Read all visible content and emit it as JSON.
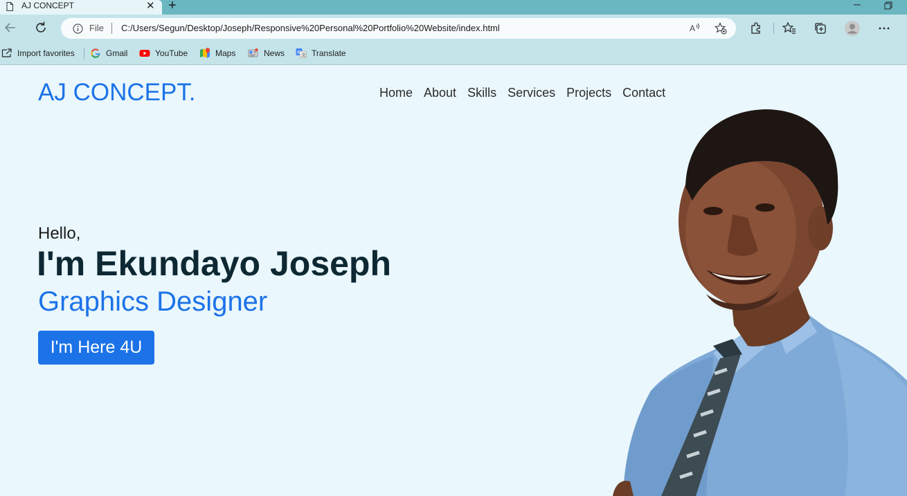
{
  "browser": {
    "tab_title": "AJ CONCEPT",
    "scheme_label": "File",
    "url": "C:/Users/Segun/Desktop/Joseph/Responsive%20Personal%20Portfolio%20Website/index.html"
  },
  "bookmarks": [
    {
      "label": "Import favorites",
      "icon": "import-favorites-icon"
    },
    {
      "label": "Gmail",
      "icon": "google-icon"
    },
    {
      "label": "YouTube",
      "icon": "youtube-icon"
    },
    {
      "label": "Maps",
      "icon": "maps-icon"
    },
    {
      "label": "News",
      "icon": "news-icon"
    },
    {
      "label": "Translate",
      "icon": "translate-icon"
    }
  ],
  "site": {
    "logo": "AJ CONCEPT.",
    "nav": [
      "Home",
      "About",
      "Skills",
      "Services",
      "Projects",
      "Contact"
    ],
    "hero": {
      "greeting": "Hello,",
      "name": "I'm Ekundayo Joseph",
      "role": "Graphics Designer",
      "cta": "I'm Here 4U"
    }
  },
  "colors": {
    "accent": "#1c73e8",
    "page_background": "#eaf7fc",
    "heading": "#0e2833",
    "browser_frame": "#6ab7c1",
    "toolbar": "#c4e4ea"
  }
}
